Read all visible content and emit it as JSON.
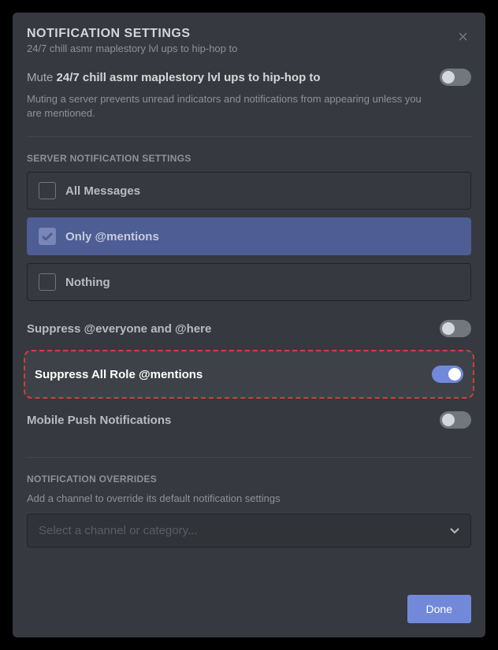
{
  "header": {
    "title": "NOTIFICATION SETTINGS",
    "subtitle": "24/7 chill asmr maplestory lvl ups to hip-hop to"
  },
  "mute": {
    "prefix": "Mute ",
    "serverName": "24/7 chill asmr maplestory lvl ups to hip-hop to",
    "description": "Muting a server prevents unread indicators and notifications from appearing unless you are mentioned."
  },
  "sections": {
    "serverNotif": "SERVER NOTIFICATION SETTINGS",
    "overrides": "NOTIFICATION OVERRIDES"
  },
  "radios": {
    "all": "All Messages",
    "mentions": "Only @mentions",
    "nothing": "Nothing"
  },
  "toggles": {
    "suppressEveryone": "Suppress @everyone and @here",
    "suppressRoles": "Suppress All Role @mentions",
    "mobilePush": "Mobile Push Notifications"
  },
  "overridesDesc": "Add a channel to override its default notification settings",
  "selectPlaceholder": "Select a channel or category...",
  "doneLabel": "Done"
}
